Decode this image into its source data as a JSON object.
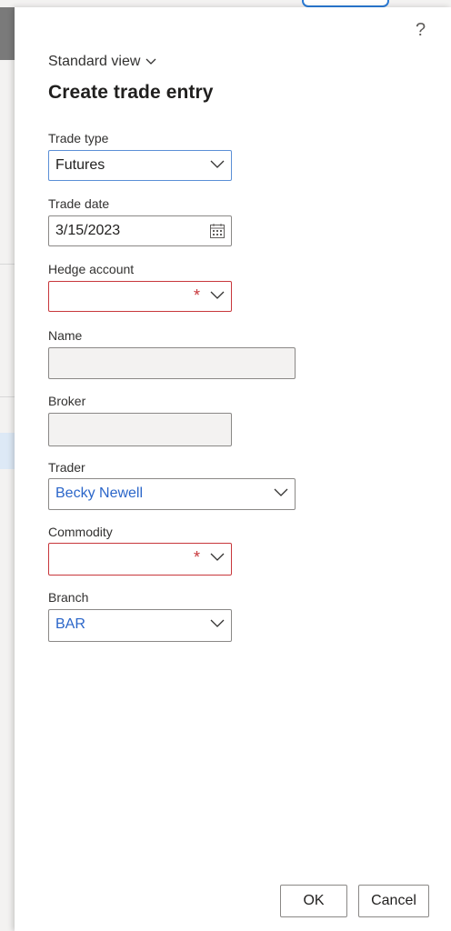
{
  "panel": {
    "help_label": "?",
    "view_selector": "Standard view",
    "title": "Create trade entry"
  },
  "fields": {
    "trade_type": {
      "label": "Trade type",
      "value": "Futures"
    },
    "trade_date": {
      "label": "Trade date",
      "value": "3/15/2023"
    },
    "hedge_account": {
      "label": "Hedge account",
      "value": "",
      "required_marker": "*"
    },
    "name": {
      "label": "Name",
      "value": ""
    },
    "broker": {
      "label": "Broker",
      "value": ""
    },
    "trader": {
      "label": "Trader",
      "value": "Becky Newell"
    },
    "commodity": {
      "label": "Commodity",
      "value": "",
      "required_marker": "*"
    },
    "branch": {
      "label": "Branch",
      "value": "BAR"
    }
  },
  "buttons": {
    "ok": "OK",
    "cancel": "Cancel"
  },
  "colors": {
    "link": "#2b66c9",
    "error": "#c8373b",
    "focus": "#5b8fd6"
  }
}
